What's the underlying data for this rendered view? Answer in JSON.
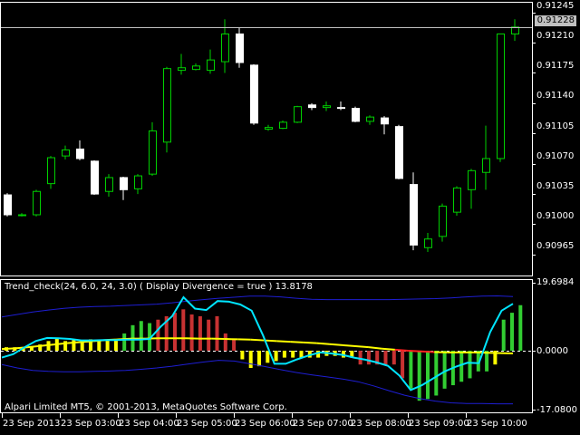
{
  "window": {
    "indicator_title": "Trend_check(24, 6.0, 24, 3.0) ( Display Divergence = true ) 13.8178",
    "copyright": "Alpari Limited MT5, © 2001-2013, MetaQuotes Software Corp.",
    "current_price": "0.91228"
  },
  "colors": {
    "background": "#000000",
    "bull_candle": "#00d000",
    "bear_candle": "#ffffff",
    "grid": "#ffffff",
    "hist_yellow": "#ffff00",
    "hist_green": "#32cd32",
    "hist_red": "#c83232",
    "cyan_line": "#00e5ff",
    "band": "#1e1ed2",
    "signal_yellow": "#ffff00",
    "signal_red": "#ff2020"
  },
  "chart_data": [
    {
      "type": "candlestick",
      "yaxis_ticks": [
        "0.91245",
        "0.91210",
        "0.91175",
        "0.91140",
        "0.91105",
        "0.91070",
        "0.91035",
        "0.91000",
        "0.90965"
      ],
      "ylim": [
        0.90945,
        0.91253
      ],
      "current_price": 0.91228,
      "candles": [
        [
          0.91034,
          0.91036,
          0.91009,
          0.91011
        ],
        [
          0.91011,
          0.91013,
          0.91009,
          0.91011
        ],
        [
          0.91011,
          0.9104,
          0.91009,
          0.91038
        ],
        [
          0.91047,
          0.91079,
          0.91041,
          0.91077
        ],
        [
          0.91079,
          0.91091,
          0.91075,
          0.91086
        ],
        [
          0.91087,
          0.91097,
          0.91074,
          0.91076
        ],
        [
          0.91073,
          0.91074,
          0.91034,
          0.91035
        ],
        [
          0.91038,
          0.91058,
          0.91032,
          0.91054
        ],
        [
          0.91054,
          0.91055,
          0.91028,
          0.9104
        ],
        [
          0.91041,
          0.91058,
          0.91035,
          0.91056
        ],
        [
          0.91058,
          0.91118,
          0.91056,
          0.91108
        ],
        [
          0.91095,
          0.91182,
          0.91083,
          0.9118
        ],
        [
          0.91178,
          0.91197,
          0.91173,
          0.91181
        ],
        [
          0.91179,
          0.91186,
          0.91178,
          0.91183
        ],
        [
          0.91178,
          0.91202,
          0.91174,
          0.9119
        ],
        [
          0.91188,
          0.91237,
          0.91175,
          0.9122
        ],
        [
          0.9122,
          0.91228,
          0.91181,
          0.91187
        ],
        [
          0.91184,
          0.91185,
          0.91115,
          0.91117
        ],
        [
          0.9111,
          0.91115,
          0.91108,
          0.91112
        ],
        [
          0.91111,
          0.9112,
          0.9111,
          0.91118
        ],
        [
          0.91118,
          0.91137,
          0.91117,
          0.91136
        ],
        [
          0.91138,
          0.9114,
          0.91132,
          0.91135
        ],
        [
          0.91135,
          0.91142,
          0.91131,
          0.91137
        ],
        [
          0.91135,
          0.91142,
          0.91132,
          0.91134
        ],
        [
          0.91134,
          0.91136,
          0.91118,
          0.91119
        ],
        [
          0.91119,
          0.91126,
          0.91115,
          0.91124
        ],
        [
          0.91123,
          0.91125,
          0.91104,
          0.91116
        ],
        [
          0.91113,
          0.91115,
          0.91052,
          0.91053
        ],
        [
          0.91046,
          0.9106,
          0.9097,
          0.90976
        ],
        [
          0.90973,
          0.9099,
          0.90968,
          0.90983
        ],
        [
          0.90986,
          0.91024,
          0.9098,
          0.91021
        ],
        [
          0.91014,
          0.91044,
          0.9101,
          0.91042
        ],
        [
          0.9104,
          0.91064,
          0.91018,
          0.91062
        ],
        [
          0.9106,
          0.91114,
          0.9104,
          0.91076
        ],
        [
          0.91076,
          0.9122,
          0.91072,
          0.9122
        ],
        [
          0.9122,
          0.91237,
          0.91212,
          0.91228
        ]
      ]
    },
    {
      "type": "bar",
      "ylim": [
        -17.08,
        19.6984
      ],
      "yaxis_ticks": [
        "19.6984",
        "0.0000",
        "-17.0800"
      ],
      "bar_values": [
        1.0,
        1.0,
        1.0,
        1.0,
        1.8,
        2.8,
        3.8,
        2.8,
        3.4,
        2.8,
        3.3,
        3.2,
        3.2,
        3.2,
        5.0,
        7.4,
        8.6,
        8.0,
        9.0,
        10.0,
        11.0,
        12.0,
        10.5,
        10.0,
        9.0,
        10.0,
        5.0,
        3.5,
        -2.5,
        -5.0,
        -4.5,
        -3.5,
        -3.0,
        -2.0,
        -2.0,
        -2.0,
        -2.0,
        -2.0,
        -1.5,
        -1.5,
        -2.0,
        -2.0,
        -4.0,
        -4.0,
        -4.0,
        -4.0,
        -4.0,
        -8.0,
        -11.0,
        -14.5,
        -14.0,
        -13.0,
        -11.0,
        -10.0,
        -9.0,
        -8.0,
        -6.0,
        -6.0,
        -4.0,
        9.0,
        11.0,
        13.2
      ],
      "bar_colors": [
        "y",
        "y",
        "y",
        "y",
        "y",
        "y",
        "y",
        "y",
        "y",
        "y",
        "y",
        "y",
        "y",
        "y",
        "g",
        "g",
        "g",
        "g",
        "r",
        "r",
        "r",
        "r",
        "r",
        "r",
        "r",
        "r",
        "r",
        "r",
        "y",
        "y",
        "y",
        "y",
        "y",
        "y",
        "y",
        "y",
        "y",
        "y",
        "y",
        "y",
        "y",
        "y",
        "r",
        "r",
        "r",
        "r",
        "r",
        "r",
        "g",
        "g",
        "g",
        "g",
        "g",
        "g",
        "g",
        "g",
        "g",
        "g",
        "y",
        "g",
        "g",
        "g"
      ],
      "cyan_line": [
        -2.0,
        -1.0,
        1.0,
        2.8,
        3.7,
        3.6,
        3.4,
        3.0,
        3.0,
        3.1,
        3.1,
        3.2,
        3.2,
        3.4,
        7.0,
        10.0,
        15.5,
        12.2,
        11.8,
        14.4,
        14.2,
        13.4,
        11.6,
        4.4,
        -3.8,
        -3.8,
        -2.5,
        -1.4,
        -0.5,
        -0.8,
        -1.2,
        -2.0,
        -2.6,
        -3.4,
        -4.4,
        -7.2,
        -11.4,
        -10.0,
        -8.0,
        -6.0,
        -4.6,
        -3.5,
        -3.6,
        5.4,
        11.6,
        13.6
      ],
      "signal_line": [
        0.5,
        0.7,
        1.0,
        1.4,
        1.8,
        2.2,
        2.5,
        2.8,
        3.1,
        3.3,
        3.5,
        3.5,
        3.6,
        3.6,
        3.6,
        3.5,
        3.5,
        3.4,
        3.3,
        3.2,
        3.0,
        2.8,
        2.6,
        2.4,
        2.2,
        1.9,
        1.6,
        1.3,
        1.0,
        0.6,
        0.3,
        0.0,
        -0.2,
        -0.4,
        -0.5,
        -0.5,
        -0.5,
        -0.6,
        -0.7,
        -0.8
      ],
      "upper_band": [
        9.8,
        10.5,
        11.2,
        11.8,
        12.3,
        12.6,
        12.8,
        12.9,
        13.1,
        13.3,
        13.5,
        13.9,
        14.4,
        14.8,
        15.2,
        15.5,
        15.8,
        15.8,
        15.6,
        15.2,
        14.9,
        14.8,
        14.8,
        14.8,
        14.8,
        14.8,
        14.9,
        15.0,
        15.1,
        15.3,
        15.6,
        15.8,
        15.9,
        15.7
      ],
      "lower_band": [
        -4.0,
        -5.0,
        -5.7,
        -6.0,
        -6.1,
        -6.1,
        -6.0,
        -5.9,
        -5.7,
        -5.4,
        -5.0,
        -4.5,
        -3.9,
        -3.3,
        -2.8,
        -3.0,
        -3.8,
        -4.6,
        -5.5,
        -6.3,
        -7.0,
        -7.6,
        -8.2,
        -9.0,
        -10.2,
        -11.6,
        -12.9,
        -13.9,
        -14.6,
        -15.1,
        -15.3,
        -15.3,
        -15.4,
        -15.4
      ]
    }
  ],
  "xaxis": {
    "labels": [
      "23 Sep 2013",
      "23 Sep 03:00",
      "23 Sep 04:00",
      "23 Sep 05:00",
      "23 Sep 06:00",
      "23 Sep 07:00",
      "23 Sep 08:00",
      "23 Sep 09:00",
      "23 Sep 10:00"
    ]
  }
}
